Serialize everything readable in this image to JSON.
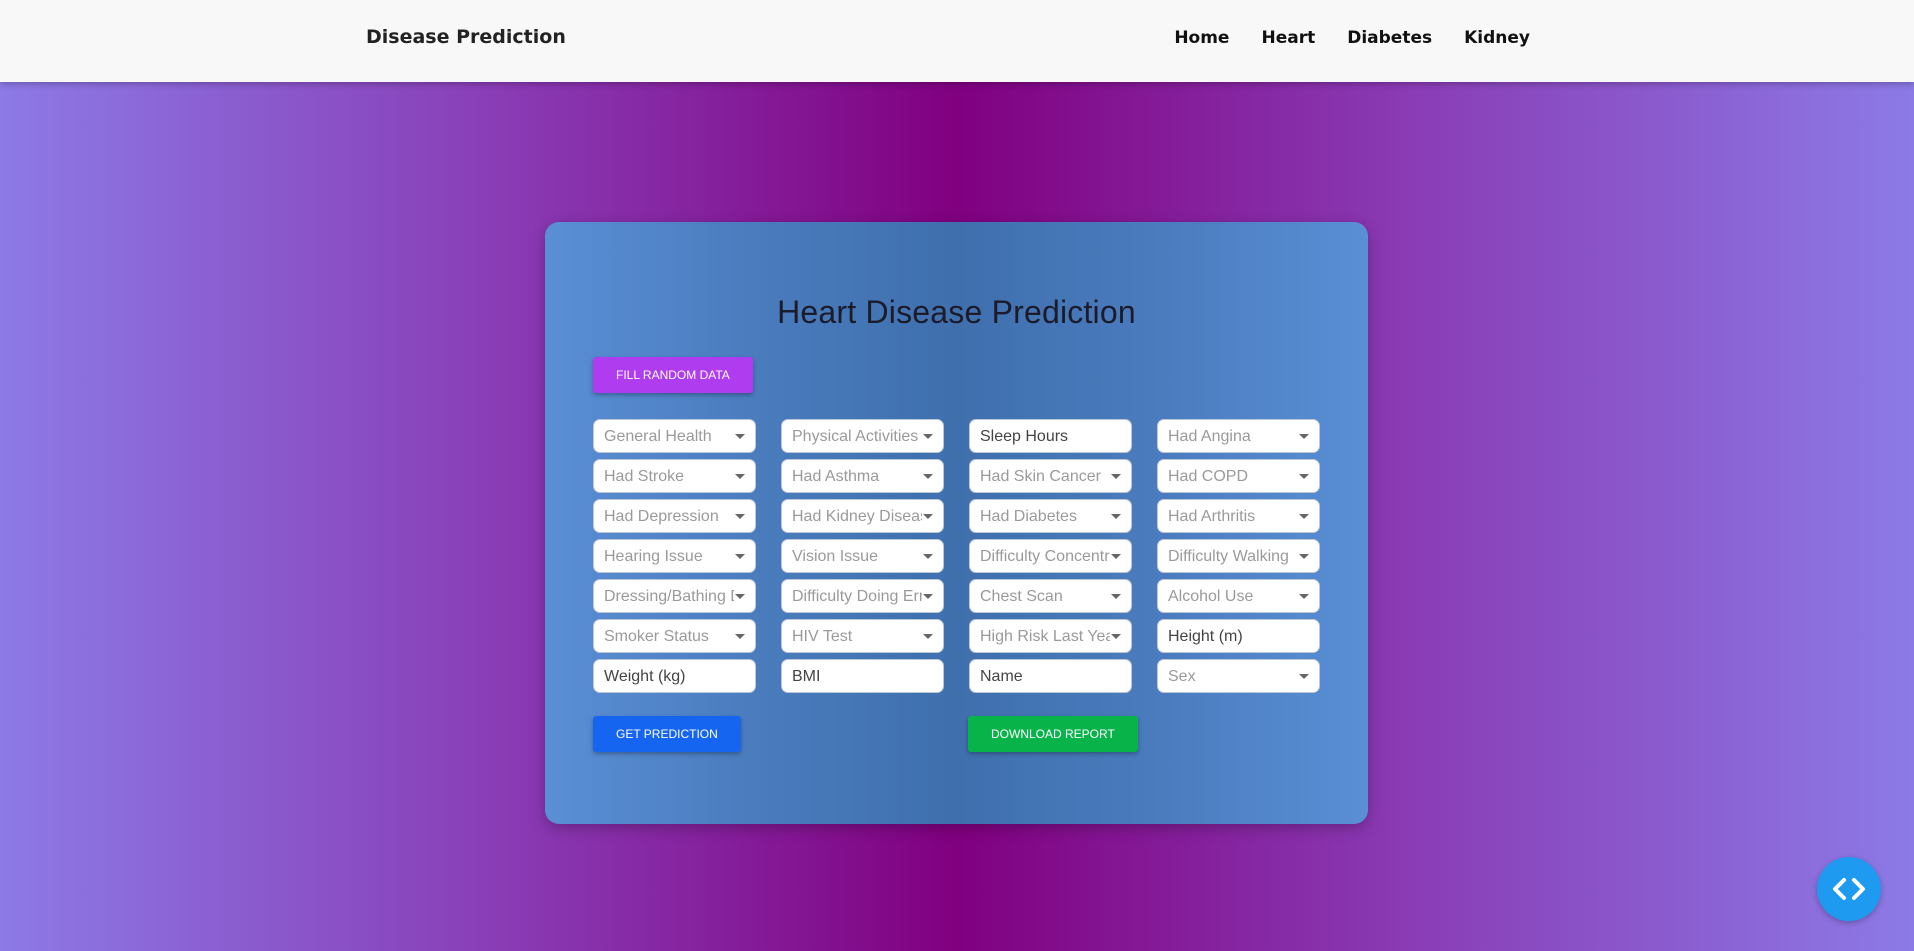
{
  "navbar": {
    "brand": "Disease Prediction",
    "links": [
      "Home",
      "Heart",
      "Diabetes",
      "Kidney"
    ]
  },
  "form": {
    "title": "Heart Disease Prediction",
    "fill_random_label": "Fill Random Data",
    "get_prediction_label": "Get Prediction",
    "download_report_label": "Download Report",
    "fields": [
      {
        "label": "General Health",
        "kind": "select"
      },
      {
        "label": "Physical Activities",
        "kind": "select"
      },
      {
        "label": "Sleep Hours",
        "kind": "input"
      },
      {
        "label": "Had Angina",
        "kind": "select"
      },
      {
        "label": "Had Stroke",
        "kind": "select"
      },
      {
        "label": "Had Asthma",
        "kind": "select"
      },
      {
        "label": "Had Skin Cancer",
        "kind": "select"
      },
      {
        "label": "Had COPD",
        "kind": "select"
      },
      {
        "label": "Had Depression",
        "kind": "select"
      },
      {
        "label": "Had Kidney Disease",
        "kind": "select"
      },
      {
        "label": "Had Diabetes",
        "kind": "select"
      },
      {
        "label": "Had Arthritis",
        "kind": "select"
      },
      {
        "label": "Hearing Issue",
        "kind": "select"
      },
      {
        "label": "Vision Issue",
        "kind": "select"
      },
      {
        "label": "Difficulty Concentrating",
        "kind": "select"
      },
      {
        "label": "Difficulty Walking",
        "kind": "select"
      },
      {
        "label": "Dressing/Bathing Difficulty",
        "kind": "select"
      },
      {
        "label": "Difficulty Doing Errands",
        "kind": "select"
      },
      {
        "label": "Chest Scan",
        "kind": "select"
      },
      {
        "label": "Alcohol Use",
        "kind": "select"
      },
      {
        "label": "Smoker Status",
        "kind": "select"
      },
      {
        "label": "HIV Test",
        "kind": "select"
      },
      {
        "label": "High Risk Last Year",
        "kind": "select"
      },
      {
        "label": "Height (m)",
        "kind": "input"
      },
      {
        "label": "Weight (kg)",
        "kind": "input"
      },
      {
        "label": "BMI",
        "kind": "input"
      },
      {
        "label": "Name",
        "kind": "input"
      },
      {
        "label": "Sex",
        "kind": "select"
      }
    ]
  },
  "colors": {
    "fill_random": "#b03cf0",
    "get_prediction": "#1565f0",
    "download_report": "#08b44a",
    "code_button": "#1e9bf0"
  },
  "icons": {
    "code_toggle": "code-brackets-icon",
    "select_caret": "caret-down-icon"
  }
}
